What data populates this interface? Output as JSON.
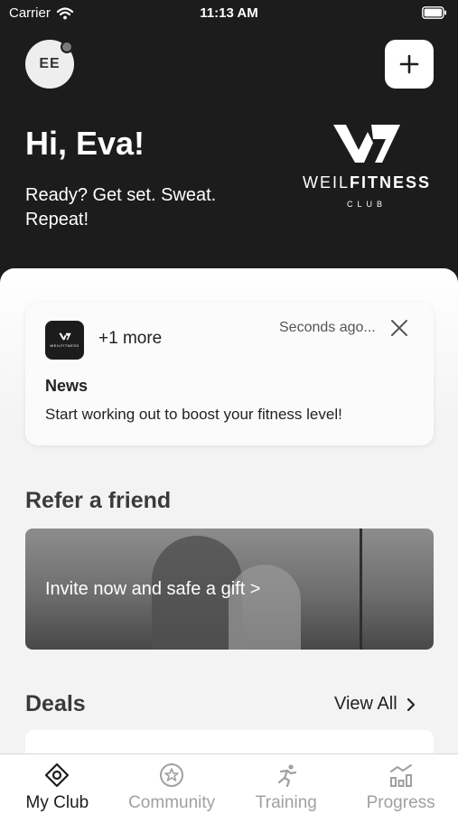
{
  "status_bar": {
    "carrier": "Carrier",
    "time": "11:13 AM"
  },
  "header": {
    "avatar_initials": "EE",
    "greeting": "Hi, Eva!",
    "tagline": "Ready? Get set. Sweat. Repeat!",
    "brand": {
      "name_light": "WEIL",
      "name_bold": "FITNESS",
      "sub": "CLUB"
    }
  },
  "notification": {
    "more": "+1 more",
    "time": "Seconds ago...",
    "title": "News",
    "text": "Start working out to boost your fitness level!"
  },
  "refer": {
    "title": "Refer a friend",
    "cta": "Invite now and safe a gift >"
  },
  "deals": {
    "title": "Deals",
    "view_all": "View All"
  },
  "tabs": [
    {
      "label": "My Club",
      "icon": "target-icon",
      "active": true
    },
    {
      "label": "Community",
      "icon": "star-circle-icon",
      "active": false
    },
    {
      "label": "Training",
      "icon": "running-icon",
      "active": false
    },
    {
      "label": "Progress",
      "icon": "chart-icon",
      "active": false
    }
  ],
  "colors": {
    "dark": "#1c1c1c",
    "inactive": "#a0a0a0"
  }
}
